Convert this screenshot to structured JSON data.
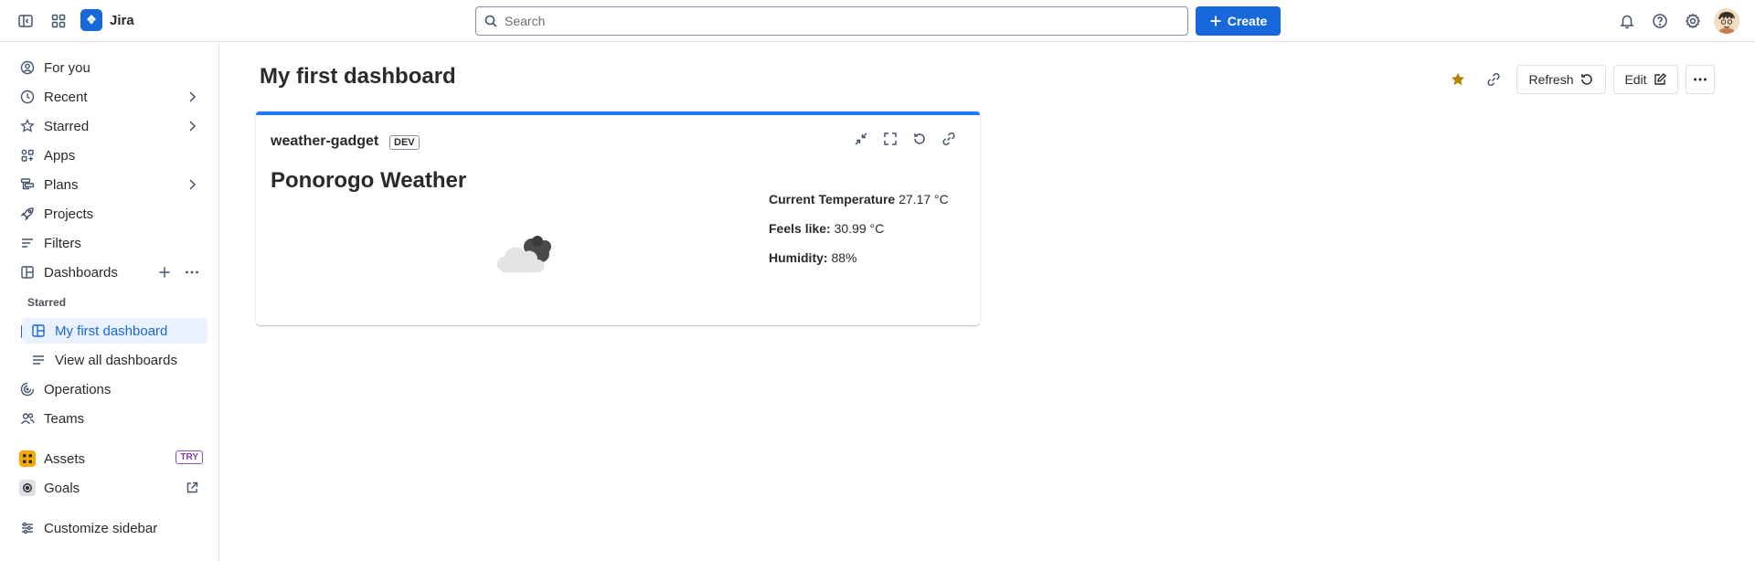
{
  "app": {
    "name": "Jira"
  },
  "topbar": {
    "search_placeholder": "Search",
    "create_label": "Create"
  },
  "sidebar": {
    "items": [
      {
        "label": "For you"
      },
      {
        "label": "Recent"
      },
      {
        "label": "Starred"
      },
      {
        "label": "Apps"
      },
      {
        "label": "Plans"
      },
      {
        "label": "Projects"
      },
      {
        "label": "Filters"
      },
      {
        "label": "Dashboards"
      }
    ],
    "starred_heading": "Starred",
    "dash_items": [
      {
        "label": "My first dashboard"
      },
      {
        "label": "View all dashboards"
      }
    ],
    "lower_items": [
      {
        "label": "Operations"
      },
      {
        "label": "Teams"
      }
    ],
    "assets_label": "Assets",
    "assets_badge": "TRY",
    "goals_label": "Goals",
    "customize_label": "Customize sidebar"
  },
  "dashboard": {
    "title": "My first dashboard",
    "refresh_label": "Refresh",
    "edit_label": "Edit",
    "star_color": "#b38600"
  },
  "gadget": {
    "name": "weather-gadget",
    "badge": "DEV",
    "heading": "Ponorogo Weather",
    "stats": [
      {
        "label": "Current Temperature",
        "value": "27.17 °C"
      },
      {
        "label": "Feels like:",
        "value": "30.99 °C"
      },
      {
        "label": "Humidity:",
        "value": "88%"
      }
    ],
    "accent_color": "#1d7afc"
  }
}
